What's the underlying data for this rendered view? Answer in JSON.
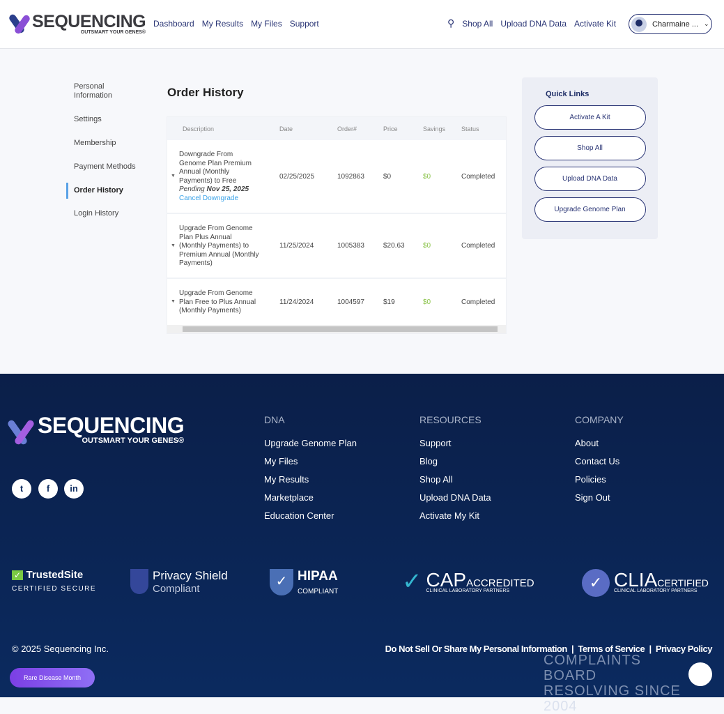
{
  "header": {
    "brand": "SEQUENCING",
    "tagline": "OUTSMART YOUR GENES®",
    "nav": [
      "Dashboard",
      "My Results",
      "My Files",
      "Support"
    ],
    "right_nav": [
      "Shop All",
      "Upload DNA Data",
      "Activate Kit"
    ],
    "user": "Charmaine ..."
  },
  "sidebar": [
    "Personal Information",
    "Settings",
    "Membership",
    "Payment Methods",
    "Order History",
    "Login History"
  ],
  "title": "Order History",
  "table": {
    "headers": [
      "Description",
      "Date",
      "Order#",
      "Price",
      "Savings",
      "Status"
    ],
    "rows": [
      {
        "desc": "Downgrade From Genome Plan Premium Annual (Monthly Payments) to Free",
        "pending": "Pending",
        "pending_date": "Nov 25, 2025",
        "action": "Cancel Downgrade",
        "date": "02/25/2025",
        "order": "1092863",
        "price": "$0",
        "savings": "$0",
        "status": "Completed"
      },
      {
        "desc": "Upgrade From Genome Plan Plus Annual (Monthly Payments) to Premium Annual (Monthly Payments)",
        "date": "11/25/2024",
        "order": "1005383",
        "price": "$20.63",
        "savings": "$0",
        "status": "Completed"
      },
      {
        "desc": "Upgrade From Genome Plan Free to Plus Annual (Monthly Payments)",
        "date": "11/24/2024",
        "order": "1004597",
        "price": "$19",
        "savings": "$0",
        "status": "Completed"
      }
    ]
  },
  "quick_links": {
    "title": "Quick Links",
    "buttons": [
      "Activate A Kit",
      "Shop All",
      "Upload DNA Data",
      "Upgrade Genome Plan"
    ]
  },
  "footer": {
    "dna": {
      "title": "DNA",
      "links": [
        "Upgrade Genome Plan",
        "My Files",
        "My Results",
        "Marketplace",
        "Education Center"
      ]
    },
    "resources": {
      "title": "RESOURCES",
      "links": [
        "Support",
        "Blog",
        "Shop All",
        "Upload DNA Data",
        "Activate My Kit"
      ]
    },
    "company": {
      "title": "COMPANY",
      "links": [
        "About",
        "Contact Us",
        "Policies",
        "Sign Out"
      ]
    },
    "badges": {
      "trusted": "TrustedSite",
      "trusted_sub": "CERTIFIED SECURE",
      "privacy": "Privacy Shield",
      "privacy_sub": "Compliant",
      "hipaa": "HIPAA",
      "hipaa_sub": "COMPLIANT",
      "cap": "CAP",
      "cap_sub": "ACCREDITED",
      "cap_small": "CLINICAL LABORATORY PARTNERS",
      "clia": "CLIA",
      "clia_sub": "CERTIFIED",
      "clia_small": "CLINICAL LABORATORY PARTNERS"
    },
    "copyright": "© 2025 Sequencing Inc.",
    "legal": [
      "Do Not Sell Or Share My Personal Information",
      "Terms of Service",
      "Privacy Policy"
    ],
    "rare": "Rare Disease Month",
    "watermark": "COMPLAINTS BOARD RESOLVING SINCE 2004"
  }
}
